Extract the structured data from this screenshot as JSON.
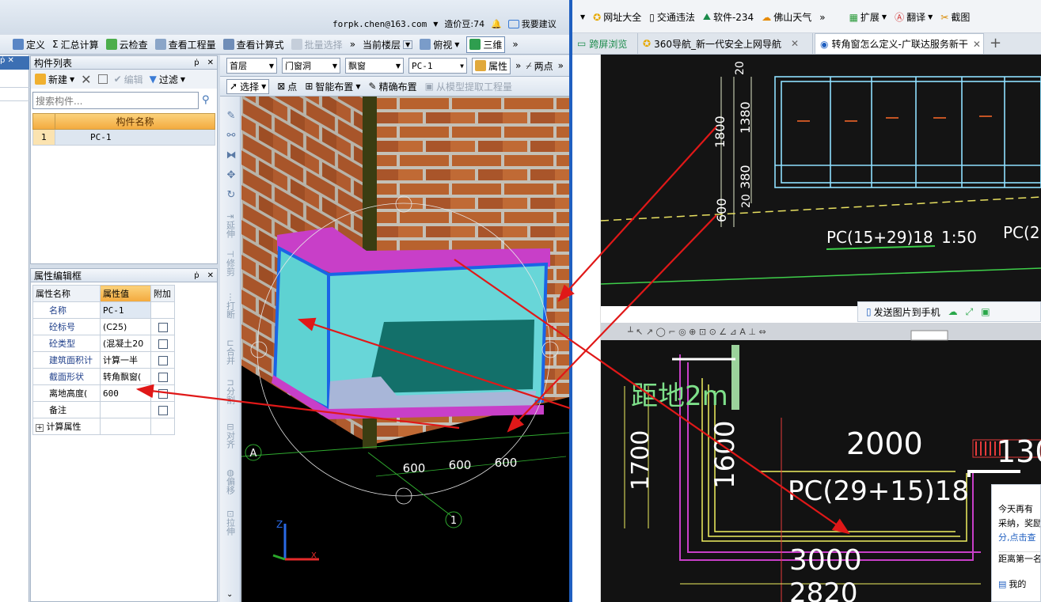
{
  "topbar": {
    "account": "forpk.chen@163.com",
    "points": "造价豆:74",
    "suggest": "我要建议"
  },
  "toolbar1": {
    "define": "定义",
    "sum": "汇总计算",
    "cloud_check": "云检查",
    "view_quantity": "查看工程量",
    "view_formula": "查看计算式",
    "batch_select": "批量选择",
    "floor": "当前楼层",
    "top_view": "俯视",
    "view3d": "三维"
  },
  "component_list": {
    "title": "构件列表",
    "new": "新建",
    "edit": "编辑",
    "filter": "过滤",
    "search_placeholder": "搜索构件...",
    "col_name": "构件名称",
    "rows": [
      {
        "no": "1",
        "name": "PC-1"
      }
    ]
  },
  "filters": {
    "floor": "首层",
    "category": "门窗洞",
    "type": "飘窗",
    "item": "PC-1",
    "props": "属性",
    "two_point": "两点"
  },
  "draw_tools": {
    "select": "选择",
    "point": "点",
    "smart": "智能布置",
    "precise": "精确布置",
    "extract": "从模型提取工程量"
  },
  "vertical_tools": [
    "延伸",
    "修剪",
    "打断",
    "合并",
    "分割",
    "对齐",
    "偏移",
    "拉伸"
  ],
  "property_panel": {
    "title": "属性编辑框",
    "col_name": "属性名称",
    "col_value": "属性值",
    "col_extra": "附加",
    "rows": [
      {
        "name": "名称",
        "value": "PC-1"
      },
      {
        "name": "砼标号",
        "value": "(C25)"
      },
      {
        "name": "砼类型",
        "value": "(混凝土20"
      },
      {
        "name": "建筑面积计",
        "value": "计算一半"
      },
      {
        "name": "截面形状",
        "value": "转角飘窗("
      },
      {
        "name": "离地高度(",
        "value": "600"
      },
      {
        "name": "备注",
        "value": ""
      },
      {
        "name": "计算属性",
        "value": ""
      }
    ]
  },
  "viewport": {
    "dims": [
      "600",
      "600",
      "600"
    ],
    "axis_a": "A",
    "axis_1": "1",
    "axis_z": "Z",
    "axis_x": "X"
  },
  "browser": {
    "bookmarks": [
      "网址大全",
      "交通违法",
      "软件-234",
      "佛山天气"
    ],
    "ext": "扩展",
    "translate": "翻译",
    "screenshot": "截图",
    "tabs": [
      "跨屏浏览",
      "360导航_新一代安全上网导航",
      "转角窗怎么定义-广联达服务新干"
    ],
    "send_to_phone": "发送图片到手机"
  },
  "cad1": {
    "dims": [
      "20",
      "1380",
      "1800",
      "380",
      "20",
      "600"
    ],
    "label": "PC(15+29)18",
    "scale": "1:50",
    "label_right": "PC(2"
  },
  "cad2": {
    "text_2m": "距地2m",
    "d1700": "1700",
    "d2000": "2000",
    "d1600": "1600",
    "d1300": "130",
    "pc": "PC(29+15)18",
    "d3000": "3000",
    "d2820": "2820"
  },
  "notice": {
    "line1": "今天再有",
    "line2": "采纳，奖励",
    "line3": "分,点击查",
    "line4": "距离第一名",
    "line5": "我的"
  }
}
